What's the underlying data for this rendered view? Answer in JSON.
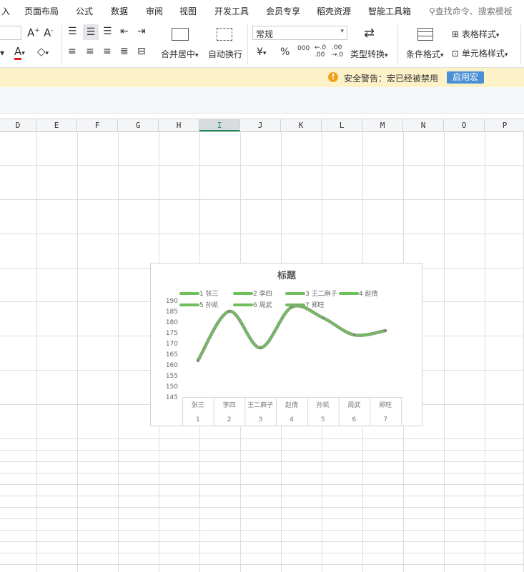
{
  "menu": {
    "items": [
      "入",
      "页面布局",
      "公式",
      "数据",
      "审阅",
      "视图",
      "开发工具",
      "会员专享",
      "稻壳资源",
      "智能工具箱"
    ],
    "search_placeholder": "查找命令、搜索模板"
  },
  "ribbon": {
    "merge_center": "合并居中",
    "auto_wrap": "自动换行",
    "number_format": "常规",
    "currency_symbol": "¥",
    "percent_symbol": "%",
    "thousands": "000",
    "decimal_increase": "←.0\n.00",
    "decimal_decrease": ".00\n→.0",
    "type_convert": "类型转换",
    "conditional_format": "条件格式",
    "table_style": "表格样式",
    "cell_style": "单元格样式"
  },
  "warning": {
    "text": "安全警告：宏已经被禁用",
    "button": "启用宏"
  },
  "columns": [
    "D",
    "E",
    "F",
    "G",
    "H",
    "I",
    "J",
    "K",
    "L",
    "M",
    "N",
    "O",
    "P"
  ],
  "selected_column": "I",
  "colors": {
    "series_line": "#6fbf5a",
    "accent_green": "#1a8f55",
    "warning_icon": "#f0a31c",
    "button_blue": "#4a8fd6"
  },
  "chart_data": {
    "type": "line",
    "title": "标题",
    "categories": [
      "张三",
      "李四",
      "王二麻子",
      "赵倩",
      "孙凯",
      "周武",
      "郑旺"
    ],
    "category_numbers": [
      "1",
      "2",
      "3",
      "4",
      "5",
      "6",
      "7"
    ],
    "legend": [
      "1 张三",
      "2 李四",
      "3 王二麻子",
      "4 赵倩",
      "5 孙凯",
      "6 周武",
      "7 郑旺"
    ],
    "values": [
      162,
      185,
      168,
      187,
      182,
      174,
      176
    ],
    "ylim": [
      145,
      190
    ],
    "yticks": [
      145,
      150,
      155,
      160,
      165,
      170,
      175,
      180,
      185,
      190
    ],
    "smooth": true,
    "legend_position": "top",
    "data_table": true
  }
}
